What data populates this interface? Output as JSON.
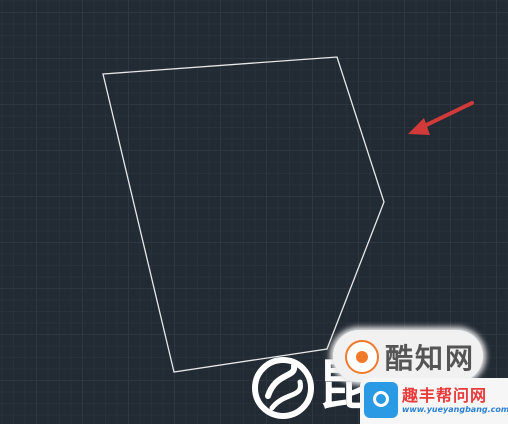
{
  "canvas": {
    "background": "#222a33",
    "grid_major_color": "#2e3741",
    "grid_minor_color": "#283039"
  },
  "drawing": {
    "shape": "pentagon",
    "stroke_color": "#e8e8e8"
  },
  "annotation": {
    "icon": "arrow-pointer-icon",
    "color": "#d23a3a"
  },
  "watermarks": {
    "badge_text": "酷知网",
    "strip_title": "趣丰帮问网",
    "strip_url": "www.yueyangbang.com",
    "left_logo_text": "ʃ",
    "middle_glyph": "昆"
  }
}
